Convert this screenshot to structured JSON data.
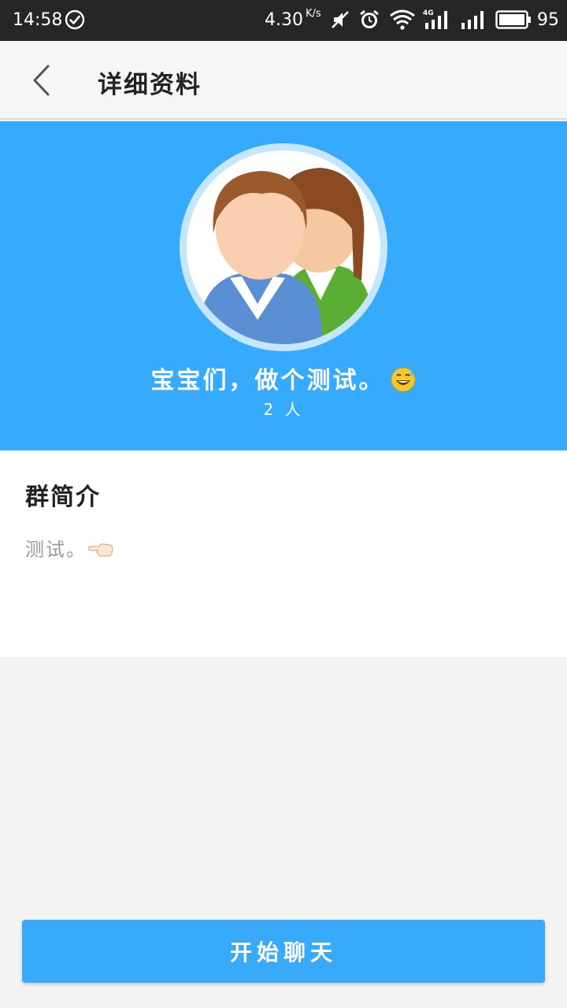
{
  "status_bar": {
    "time": "14:58",
    "net_speed": "4.30",
    "net_speed_unit": "K/s",
    "network_label": "4G",
    "battery_level": "95",
    "icons": [
      "check-circle-icon",
      "mute-icon",
      "alarm-icon",
      "wifi-icon",
      "signal-4g-icon",
      "signal-icon",
      "battery-icon"
    ]
  },
  "header": {
    "title": "详细资料",
    "back_icon": "chevron-left-icon"
  },
  "profile": {
    "group_name": "宝宝们，做个测试。",
    "group_name_emoji": "sweat-smile-emoji",
    "member_count": "2 人",
    "avatar_icon": "group-avatar-icon"
  },
  "intro": {
    "title": "群简介",
    "text": "测试。",
    "text_emoji": "pointing-left-emoji"
  },
  "actions": {
    "start_chat_label": "开始聊天"
  },
  "colors": {
    "status_bar_bg": "#262626",
    "header_bg": "#f6f6f6",
    "accent": "#36aafc",
    "page_bg": "#f3f3f3"
  }
}
